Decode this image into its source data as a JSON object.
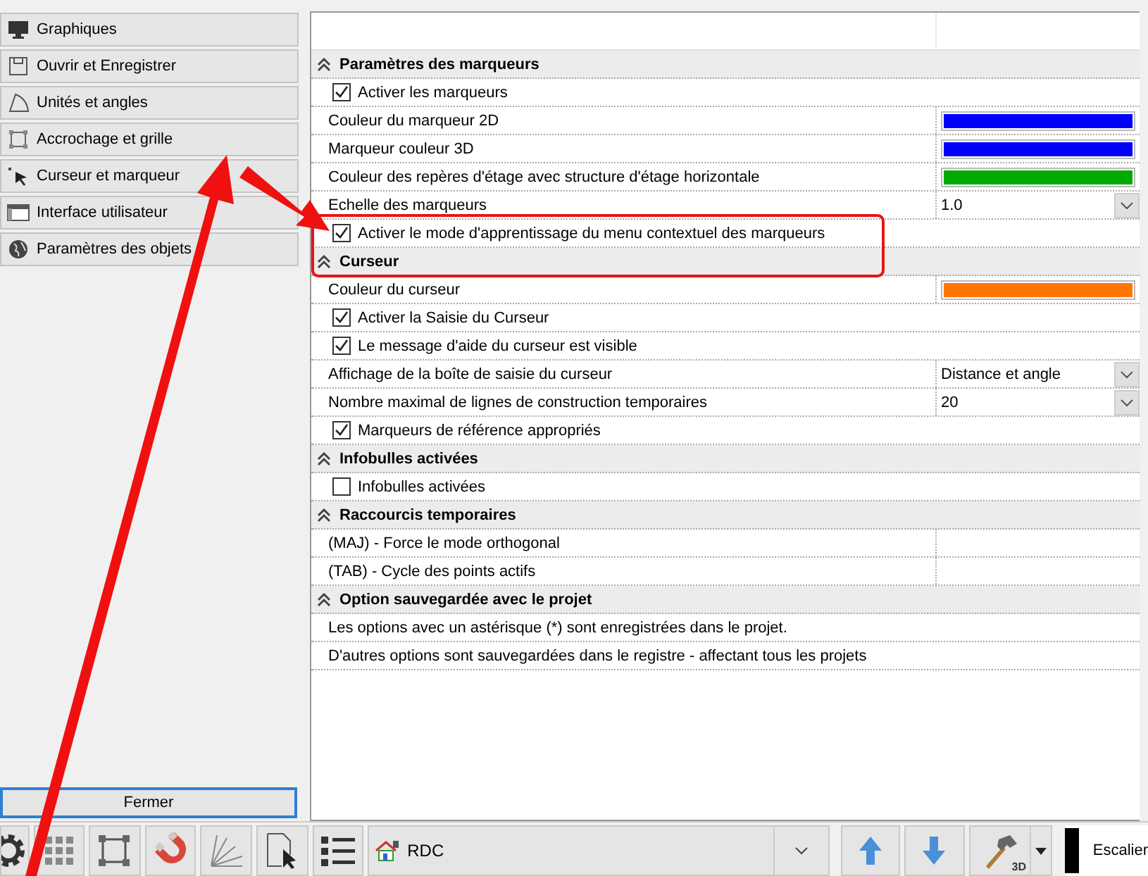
{
  "sidebar": {
    "items": [
      {
        "label": "Graphiques"
      },
      {
        "label": "Ouvrir et Enregistrer"
      },
      {
        "label": "Unités et angles"
      },
      {
        "label": "Accrochage et grille"
      },
      {
        "label": "Curseur et marqueur"
      },
      {
        "label": "Interface utilisateur"
      },
      {
        "label": "Paramètres des objets"
      }
    ],
    "close_button": "Fermer"
  },
  "properties": {
    "rows": [
      {
        "kind": "section",
        "label": "Paramètres des marqueurs",
        "expanded": true
      },
      {
        "kind": "checkbox",
        "label": "Activer les marqueurs",
        "checked": true
      },
      {
        "kind": "color",
        "label": "Couleur du marqueur 2D",
        "color": "#0000ff"
      },
      {
        "kind": "color",
        "label": "Marqueur couleur 3D",
        "color": "#0000ff"
      },
      {
        "kind": "color",
        "label": "Couleur des repères d'étage avec structure d'étage horizontale",
        "color": "#00aa00"
      },
      {
        "kind": "dropdown",
        "label": "Echelle des marqueurs",
        "value": "1.0"
      },
      {
        "kind": "checkbox",
        "label": "Activer le mode d'apprentissage du menu contextuel des marqueurs",
        "checked": true
      },
      {
        "kind": "section",
        "label": "Curseur",
        "expanded": true
      },
      {
        "kind": "color",
        "label": "Couleur du curseur",
        "color": "#ff7700"
      },
      {
        "kind": "checkbox",
        "label": "Activer la Saisie du Curseur",
        "checked": true
      },
      {
        "kind": "checkbox",
        "label": "Le message d'aide du curseur est visible",
        "checked": true
      },
      {
        "kind": "dropdown",
        "label": "Affichage de la boîte de saisie du curseur",
        "value": "Distance et angle"
      },
      {
        "kind": "dropdown",
        "label": "Nombre maximal de lignes de construction temporaires",
        "value": "20"
      },
      {
        "kind": "checkbox",
        "label": "Marqueurs de référence appropriés",
        "checked": true
      },
      {
        "kind": "section",
        "label": "Infobulles activées",
        "expanded": true
      },
      {
        "kind": "checkbox",
        "label": "Infobulles activées",
        "checked": false
      },
      {
        "kind": "section",
        "label": "Raccourcis temporaires",
        "expanded": true
      },
      {
        "kind": "text",
        "label": "(MAJ) - Force le mode orthogonal"
      },
      {
        "kind": "text",
        "label": "(TAB) - Cycle des points actifs"
      },
      {
        "kind": "section",
        "label": "Option sauvegardée avec le projet",
        "expanded": true
      },
      {
        "kind": "note",
        "label": "Les options avec un astérisque (*) sont enregistrées dans le projet."
      },
      {
        "kind": "note",
        "label": "D'autres options sont sauvegardées dans le registre - affectant tous les projets"
      }
    ]
  },
  "annotations": [
    {
      "kind": "arrow"
    },
    {
      "kind": "arrow"
    },
    {
      "kind": "frame"
    }
  ],
  "toolbar": {
    "level_select": {
      "value": "RDC"
    },
    "hammer_badge": "3D",
    "stair_label": "Escalier"
  }
}
